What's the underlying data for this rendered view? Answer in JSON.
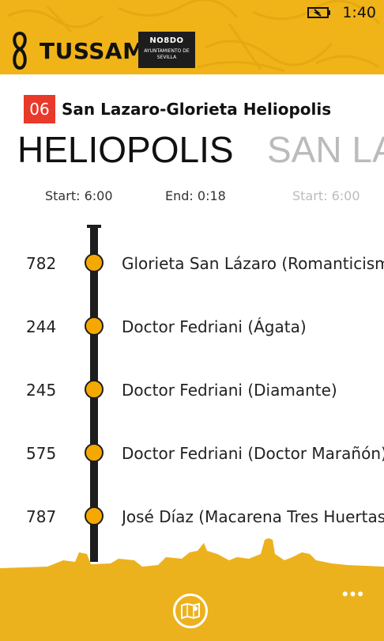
{
  "status_bar": {
    "time": "1:40"
  },
  "header": {
    "brand_name": "TUSSAM",
    "partner_motto": "NO8DO",
    "partner_org": "Ayuntamiento de Sevilla"
  },
  "route": {
    "number": "06",
    "name": "San Lazaro-Glorieta Heliopolis"
  },
  "pivot": {
    "active_direction": "HELIOPOLIS",
    "next_direction": "SAN LAZARO"
  },
  "schedule": {
    "start": "Start: 6:00",
    "end": "End: 0:18",
    "next_start": "Start: 6:00"
  },
  "stops": [
    {
      "code": "782",
      "name": "Glorieta San Lázaro (Romanticismo)"
    },
    {
      "code": "244",
      "name": "Doctor Fedriani (Ágata)"
    },
    {
      "code": "245",
      "name": "Doctor Fedriani (Diamante)"
    },
    {
      "code": "575",
      "name": "Doctor Fedriani (Doctor Marañón)"
    },
    {
      "code": "787",
      "name": "José Díaz (Macarena Tres Huertas)"
    }
  ],
  "app_bar": {
    "more": "•••"
  },
  "colors": {
    "accent_yellow": "#f0b418",
    "route_red": "#e8392a",
    "stop_dot": "#f5a800",
    "timeline": "#1d1d1d"
  },
  "icons": {
    "signal": "signal-icon",
    "battery": "battery-icon",
    "brand": "tussam-logo-icon",
    "map": "map-icon"
  }
}
